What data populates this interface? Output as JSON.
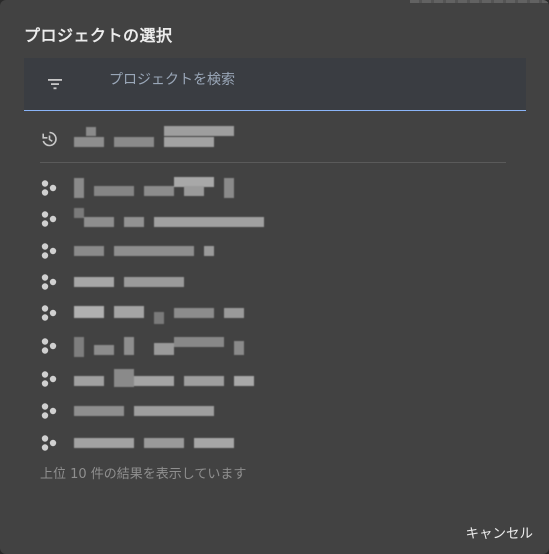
{
  "dialog": {
    "title": "プロジェクトの選択"
  },
  "search": {
    "placeholder": "プロジェクトを検索",
    "value": ""
  },
  "recent": {
    "icon": "history-icon",
    "label_redacted": true
  },
  "projects": {
    "icon": "project-hub-icon",
    "count": 10
  },
  "footer": {
    "result_note": "上位 10 件の結果を表示しています",
    "cancel_label": "キャンセル"
  },
  "colors": {
    "dialog_bg": "#424242",
    "search_bg": "#3a3d42",
    "accent": "#8ab4f8",
    "text_primary": "#ececec",
    "text_muted": "#8f8f8f"
  }
}
